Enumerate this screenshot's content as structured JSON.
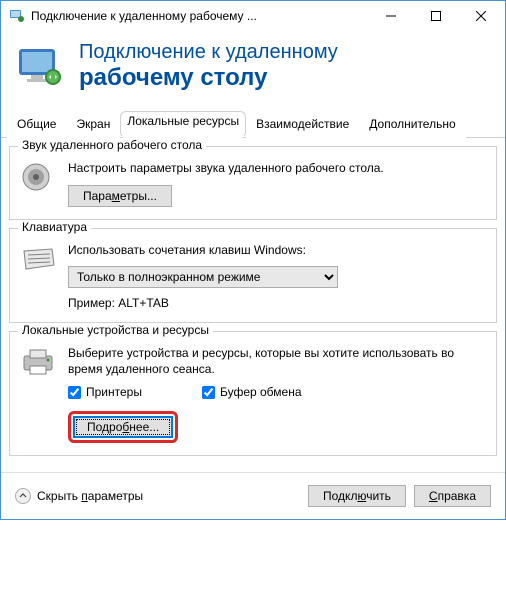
{
  "titlebar": {
    "text": "Подключение к удаленному рабочему ..."
  },
  "header": {
    "line1": "Подключение к удаленному",
    "line2": "рабочему столу"
  },
  "tabs": {
    "general": "Общие",
    "display": "Экран",
    "local": "Локальные ресурсы",
    "experience": "Взаимодействие",
    "advanced": "Дополнительно"
  },
  "audio": {
    "group_title": "Звук удаленного рабочего стола",
    "desc": "Настроить параметры звука удаленного рабочего стола.",
    "btn": "Параметры..."
  },
  "keyboard": {
    "group_title": "Клавиатура",
    "desc": "Использовать сочетания клавиш Windows:",
    "selected": "Только в полноэкранном режиме",
    "example": "Пример: ALT+TAB"
  },
  "devices": {
    "group_title": "Локальные устройства и ресурсы",
    "desc": "Выберите устройства и ресурсы, которые вы хотите использовать во время удаленного сеанса.",
    "printers": "Принтеры",
    "clipboard": "Буфер обмена",
    "more_btn": "Подробнее..."
  },
  "footer": {
    "hide": "Скрыть параметры",
    "connect": "Подключить",
    "help": "Справка"
  }
}
